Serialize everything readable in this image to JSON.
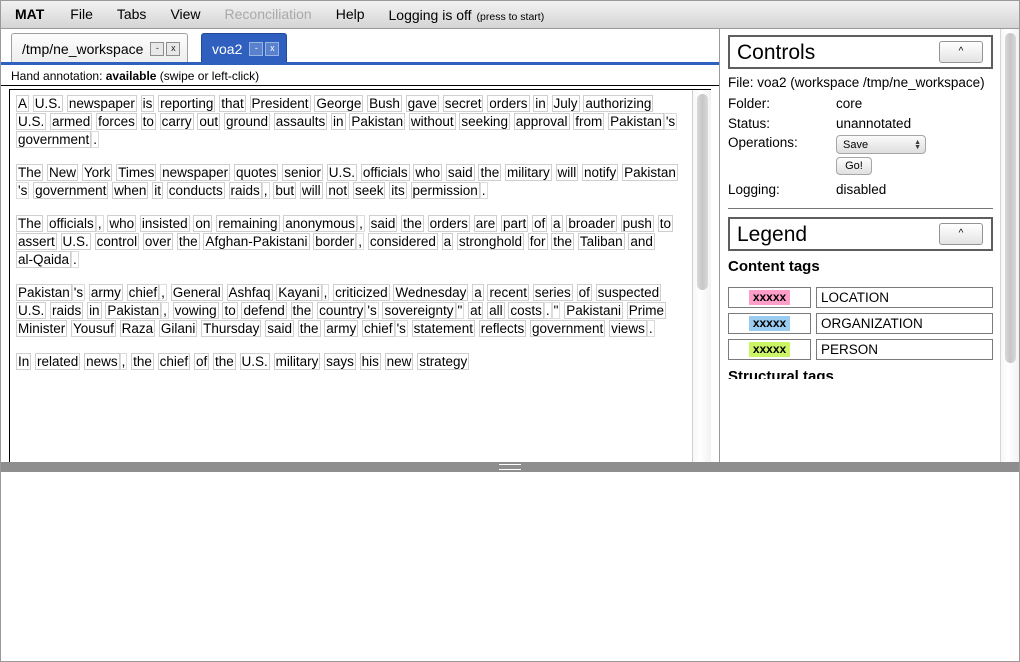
{
  "menu": {
    "brand": "MAT",
    "items": [
      {
        "label": "File",
        "disabled": false
      },
      {
        "label": "Tabs",
        "disabled": false
      },
      {
        "label": "View",
        "disabled": false
      },
      {
        "label": "Reconciliation",
        "disabled": true
      },
      {
        "label": "Help",
        "disabled": false
      }
    ],
    "logging_main": "Logging is off",
    "logging_sub": "(press to start)"
  },
  "tabs": [
    {
      "label": "/tmp/ne_workspace",
      "minimize": "-",
      "close": "x",
      "active": false
    },
    {
      "label": "voa2",
      "minimize": "-",
      "close": "x",
      "active": true
    }
  ],
  "hand_annotation": {
    "prefix": "Hand annotation:",
    "state": "available",
    "hint": "(swipe or left-click)"
  },
  "document": {
    "paragraphs": [
      [
        "A",
        "U.S.",
        "newspaper",
        "is",
        "reporting",
        "that",
        "President",
        "George",
        "Bush",
        "gave",
        "secret",
        "orders",
        "in",
        "July",
        "authorizing",
        "U.S.",
        "armed",
        "forces",
        "to",
        "carry",
        "out",
        "ground",
        "assaults",
        "in",
        "Pakistan",
        "without",
        "seeking",
        "approval",
        "from",
        "Pakistan",
        "'s",
        "government",
        "."
      ],
      [
        "The",
        "New",
        "York",
        "Times",
        "newspaper",
        "quotes",
        "senior",
        "U.S.",
        "officials",
        "who",
        "said",
        "the",
        "military",
        "will",
        "notify",
        "Pakistan",
        "'s",
        "government",
        "when",
        "it",
        "conducts",
        "raids",
        ",",
        "but",
        "will",
        "not",
        "seek",
        "its",
        "permission",
        "."
      ],
      [
        "The",
        "officials",
        ",",
        "who",
        "insisted",
        "on",
        "remaining",
        "anonymous",
        ",",
        "said",
        "the",
        "orders",
        "are",
        "part",
        "of",
        "a",
        "broader",
        "push",
        "to",
        "assert",
        "U.S.",
        "control",
        "over",
        "the",
        "Afghan-Pakistani",
        "border",
        ",",
        "considered",
        "a",
        "stronghold",
        "for",
        "the",
        "Taliban",
        "and",
        "al-Qaida",
        "."
      ],
      [
        "Pakistan",
        "'s",
        "army",
        "chief",
        ",",
        "General",
        "Ashfaq",
        "Kayani",
        ",",
        "criticized",
        "Wednesday",
        "a",
        "recent",
        "series",
        "of",
        "suspected",
        "U.S.",
        "raids",
        "in",
        "Pakistan",
        ",",
        "vowing",
        "to",
        "defend",
        "the",
        "country",
        "'s",
        "sovereignty",
        "\"",
        "at",
        "all",
        "costs",
        ".",
        "\"",
        "Pakistani",
        "Prime",
        "Minister",
        "Yousuf",
        "Raza",
        "Gilani",
        "Thursday",
        "said",
        "the",
        "army",
        "chief",
        "'s",
        "statement",
        "reflects",
        "government",
        "views",
        "."
      ],
      [
        "In",
        "related",
        "news",
        ",",
        "the",
        "chief",
        "of",
        "the",
        "U.S.",
        "military",
        "says",
        "his",
        "new",
        "strategy"
      ]
    ]
  },
  "controls": {
    "title": "Controls",
    "collapse_icon": "^",
    "file_line": "File: voa2 (workspace /tmp/ne_workspace)",
    "rows": [
      {
        "label": "Folder:",
        "value": "core"
      },
      {
        "label": "Status:",
        "value": "unannotated"
      }
    ],
    "operations_label": "Operations:",
    "operation_selected": "Save",
    "go_label": "Go!",
    "logging_label": "Logging:",
    "logging_value": "disabled"
  },
  "legend": {
    "title": "Legend",
    "collapse_icon": "^",
    "heading": "Content tags",
    "swatch_text": "xxxxx",
    "tags": [
      {
        "name": "LOCATION",
        "color": "#ff9ec9"
      },
      {
        "name": "ORGANIZATION",
        "color": "#9acbf0"
      },
      {
        "name": "PERSON",
        "color": "#ccf566"
      }
    ],
    "next_heading_clipped": "Structural tags"
  }
}
